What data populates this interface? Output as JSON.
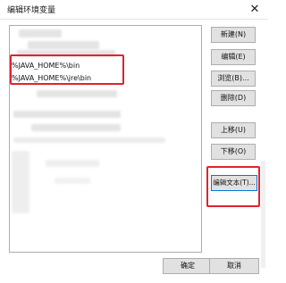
{
  "window": {
    "title": "编辑环境变量",
    "close_glyph": "✕"
  },
  "list": {
    "visible_entries": [
      "%JAVA_HOME%\\bin",
      "%JAVA_HOME%\\jre\\bin"
    ]
  },
  "buttons": {
    "new": "新建(N)",
    "edit": "编辑(E)",
    "browse": "浏览(B)...",
    "delete": "删除(D)",
    "move_up": "上移(U)",
    "move_down": "下移(O)",
    "edit_text": "编辑文本(T)..."
  },
  "footer": {
    "ok": "确定",
    "cancel": "取消"
  },
  "colors": {
    "highlight": "#e0232e",
    "focus": "#0078d7"
  }
}
